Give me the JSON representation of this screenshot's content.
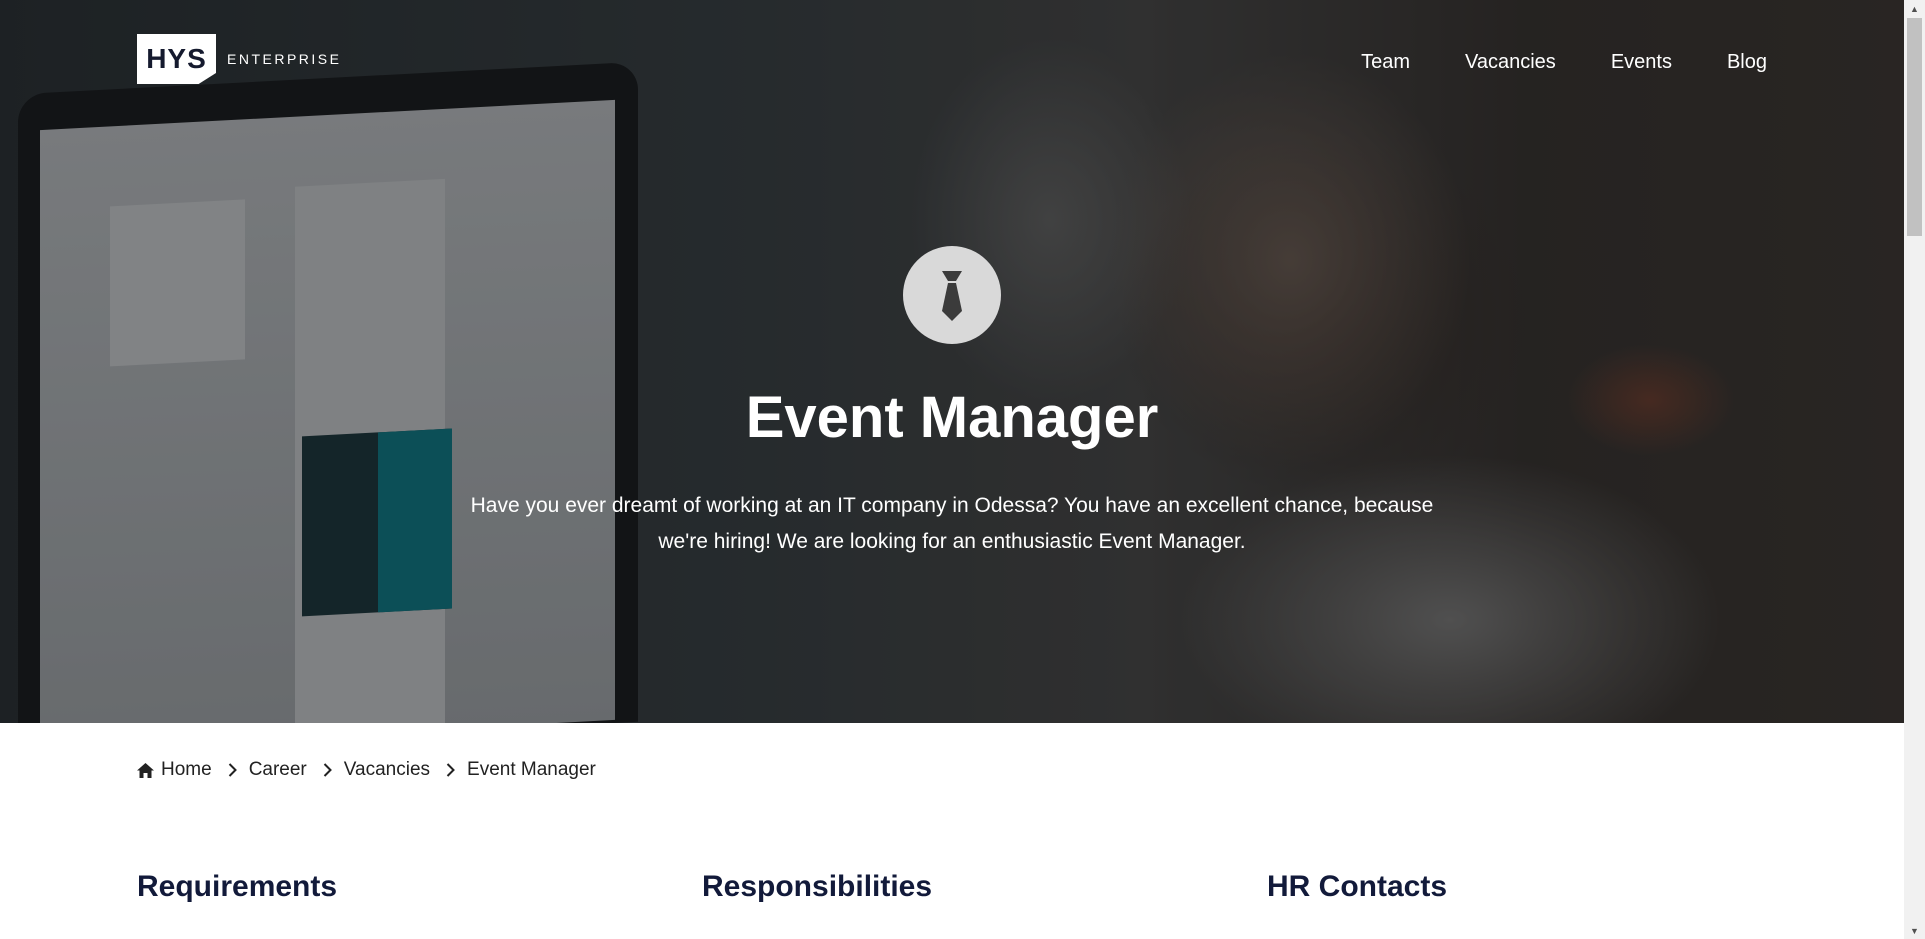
{
  "header": {
    "logo_mark": "HYS",
    "logo_text": "ENTERPRISE",
    "nav": [
      {
        "label": "Team"
      },
      {
        "label": "Vacancies"
      },
      {
        "label": "Events"
      },
      {
        "label": "Blog"
      }
    ]
  },
  "hero": {
    "icon": "necktie-icon",
    "title": "Event Manager",
    "description": "Have you ever dreamt of working at an IT company in Odessa? You have an excellent chance, because we're hiring! We are looking for an enthusiastic Event Manager."
  },
  "breadcrumb": {
    "home": "Home",
    "items": [
      "Career",
      "Vacancies",
      "Event Manager"
    ]
  },
  "sections": {
    "requirements": "Requirements",
    "responsibilities": "Responsibilities",
    "hr_contacts": "HR Contacts"
  },
  "colors": {
    "heading": "#121a3a",
    "text": "#222222",
    "icon_circle": "#d9d9d9"
  }
}
